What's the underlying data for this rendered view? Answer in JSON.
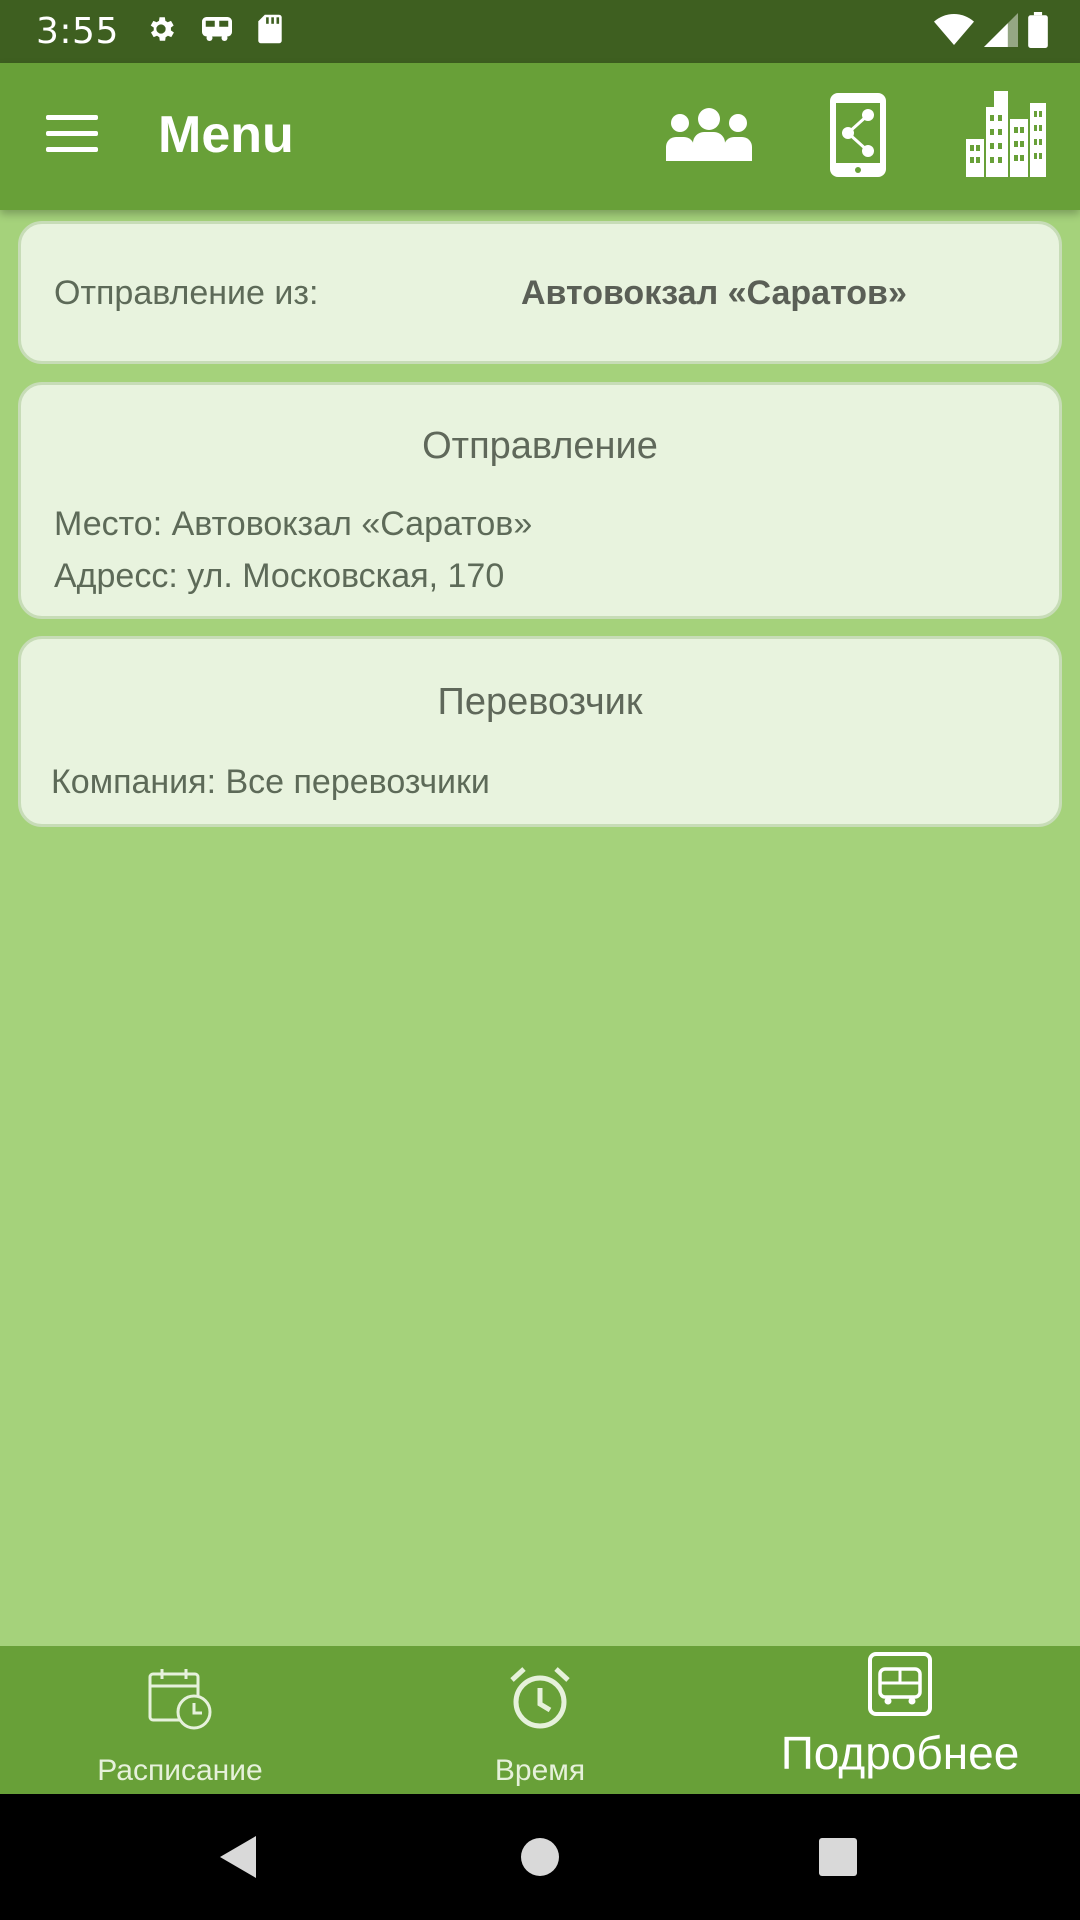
{
  "status_bar": {
    "time": "3:55",
    "icons_left": [
      "gear-icon",
      "bus-icon",
      "sd-card-icon"
    ],
    "icons_right": [
      "wifi-icon",
      "signal-icon",
      "battery-icon"
    ]
  },
  "app_bar": {
    "title": "Menu",
    "actions": [
      "group-icon",
      "share-phone-icon",
      "city-icon"
    ]
  },
  "departure_from": {
    "label": "Отправление из:",
    "value": "Автовокзал «Саратов»"
  },
  "departure_card": {
    "title": "Отправление",
    "place": "Место: Автовокзал «Саратов»",
    "address": "Адресс: ул. Московская, 170"
  },
  "carrier_card": {
    "title": "Перевозчик",
    "company": "Компания: Все перевозчики"
  },
  "bottom_nav": {
    "items": [
      {
        "label": "Расписание",
        "icon": "calendar-clock-icon"
      },
      {
        "label": "Время",
        "icon": "alarm-clock-icon"
      },
      {
        "label": "Подробнее",
        "icon": "bus-icon",
        "selected": true
      }
    ]
  },
  "colors": {
    "status_bar": "#3e5f20",
    "app_bar": "#68a038",
    "background": "#a5d27b",
    "card": "#e8f3de"
  }
}
